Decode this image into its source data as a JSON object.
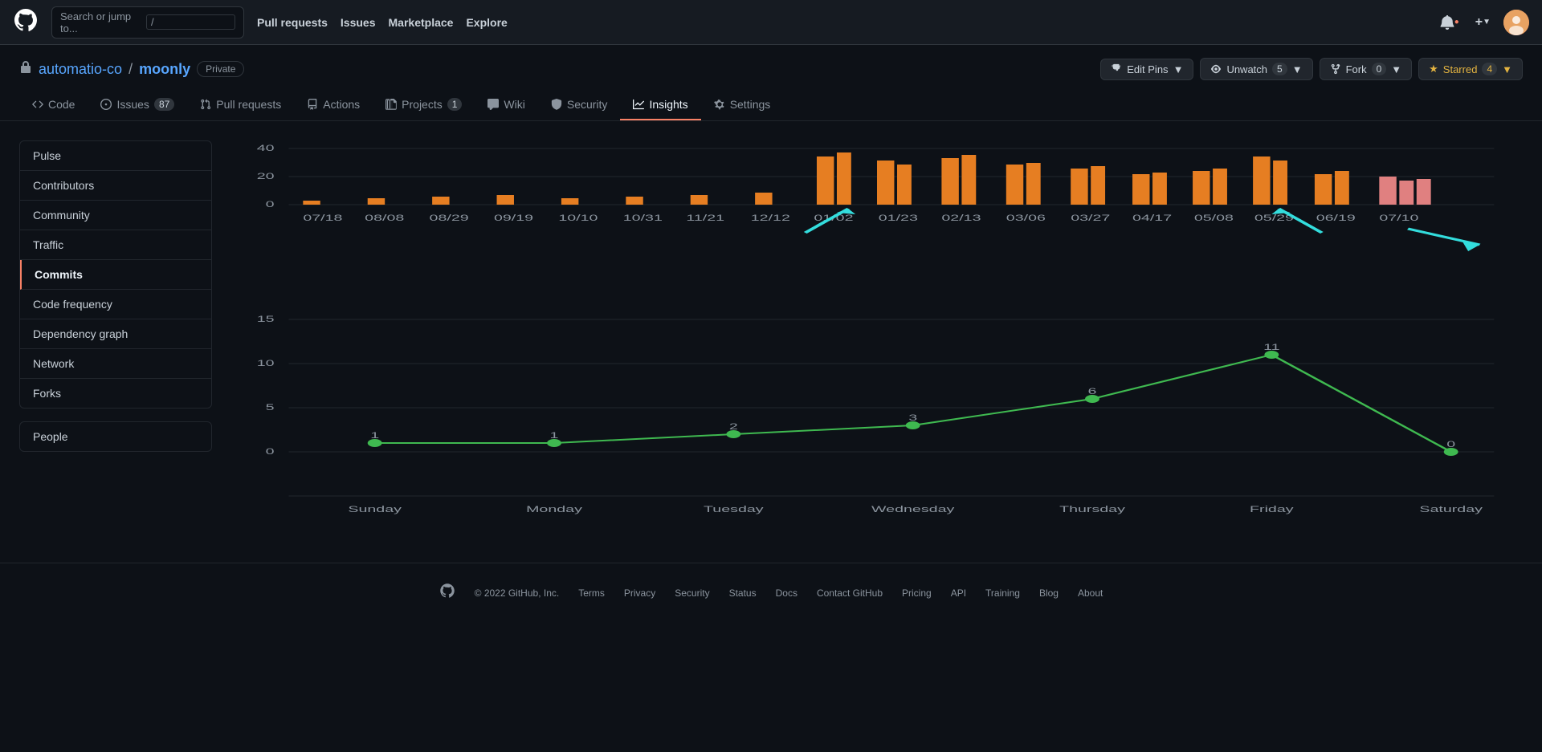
{
  "topnav": {
    "logo": "⬤",
    "search_placeholder": "Search or jump to...",
    "slash_label": "/",
    "links": [
      {
        "label": "Pull requests",
        "name": "pull-requests-link"
      },
      {
        "label": "Issues",
        "name": "issues-link"
      },
      {
        "label": "Marketplace",
        "name": "marketplace-link"
      },
      {
        "label": "Explore",
        "name": "explore-link"
      }
    ],
    "bell_icon": "🔔",
    "plus_icon": "+",
    "avatar_label": "A"
  },
  "repo": {
    "owner": "automatio-co",
    "sep": "/",
    "name": "moonly",
    "private_label": "Private",
    "edit_pins_label": "Edit Pins",
    "unwatch_label": "Unwatch",
    "unwatch_count": "5",
    "fork_label": "Fork",
    "fork_count": "0",
    "starred_label": "Starred",
    "starred_count": "4"
  },
  "tabs": [
    {
      "label": "Code",
      "icon": "<>",
      "name": "tab-code",
      "active": false
    },
    {
      "label": "Issues",
      "badge": "87",
      "name": "tab-issues",
      "active": false
    },
    {
      "label": "Pull requests",
      "name": "tab-pullrequests",
      "active": false
    },
    {
      "label": "Actions",
      "name": "tab-actions",
      "active": false
    },
    {
      "label": "Projects",
      "badge": "1",
      "name": "tab-projects",
      "active": false
    },
    {
      "label": "Wiki",
      "name": "tab-wiki",
      "active": false
    },
    {
      "label": "Security",
      "name": "tab-security",
      "active": false
    },
    {
      "label": "Insights",
      "name": "tab-insights",
      "active": true
    },
    {
      "label": "Settings",
      "name": "tab-settings",
      "active": false
    }
  ],
  "sidebar": {
    "items": [
      {
        "label": "Pulse",
        "name": "sidebar-pulse",
        "active": false
      },
      {
        "label": "Contributors",
        "name": "sidebar-contributors",
        "active": false
      },
      {
        "label": "Community",
        "name": "sidebar-community",
        "active": false
      },
      {
        "label": "Traffic",
        "name": "sidebar-traffic",
        "active": false
      },
      {
        "label": "Commits",
        "name": "sidebar-commits",
        "active": true
      },
      {
        "label": "Code frequency",
        "name": "sidebar-code-frequency",
        "active": false
      },
      {
        "label": "Dependency graph",
        "name": "sidebar-dependency-graph",
        "active": false
      },
      {
        "label": "Network",
        "name": "sidebar-network",
        "active": false
      },
      {
        "label": "Forks",
        "name": "sidebar-forks",
        "active": false
      }
    ],
    "people_label": "People"
  },
  "bar_chart": {
    "y_labels": [
      "40",
      "20",
      "0"
    ],
    "x_labels": [
      "07/18",
      "08/08",
      "08/29",
      "09/19",
      "10/10",
      "10/31",
      "11/21",
      "12/12",
      "01/02",
      "01/23",
      "02/13",
      "03/06",
      "03/27",
      "04/17",
      "05/08",
      "05/29",
      "06/19",
      "07/10"
    ]
  },
  "line_chart": {
    "y_labels": [
      "15",
      "10",
      "5",
      "0"
    ],
    "x_labels": [
      "Sunday",
      "Monday",
      "Tuesday",
      "Wednesday",
      "Thursday",
      "Friday",
      "Saturday"
    ],
    "points": [
      {
        "day": "Sunday",
        "val": 1
      },
      {
        "day": "Monday",
        "val": 1
      },
      {
        "day": "Tuesday",
        "val": 2
      },
      {
        "day": "Wednesday",
        "val": 3
      },
      {
        "day": "Thursday",
        "val": 6
      },
      {
        "day": "Friday",
        "val": 11
      },
      {
        "day": "Saturday",
        "val": 0
      }
    ]
  },
  "footer": {
    "copyright": "© 2022 GitHub, Inc.",
    "links": [
      "Terms",
      "Privacy",
      "Security",
      "Status",
      "Docs",
      "Contact GitHub",
      "Pricing",
      "API",
      "Training",
      "Blog",
      "About"
    ]
  }
}
